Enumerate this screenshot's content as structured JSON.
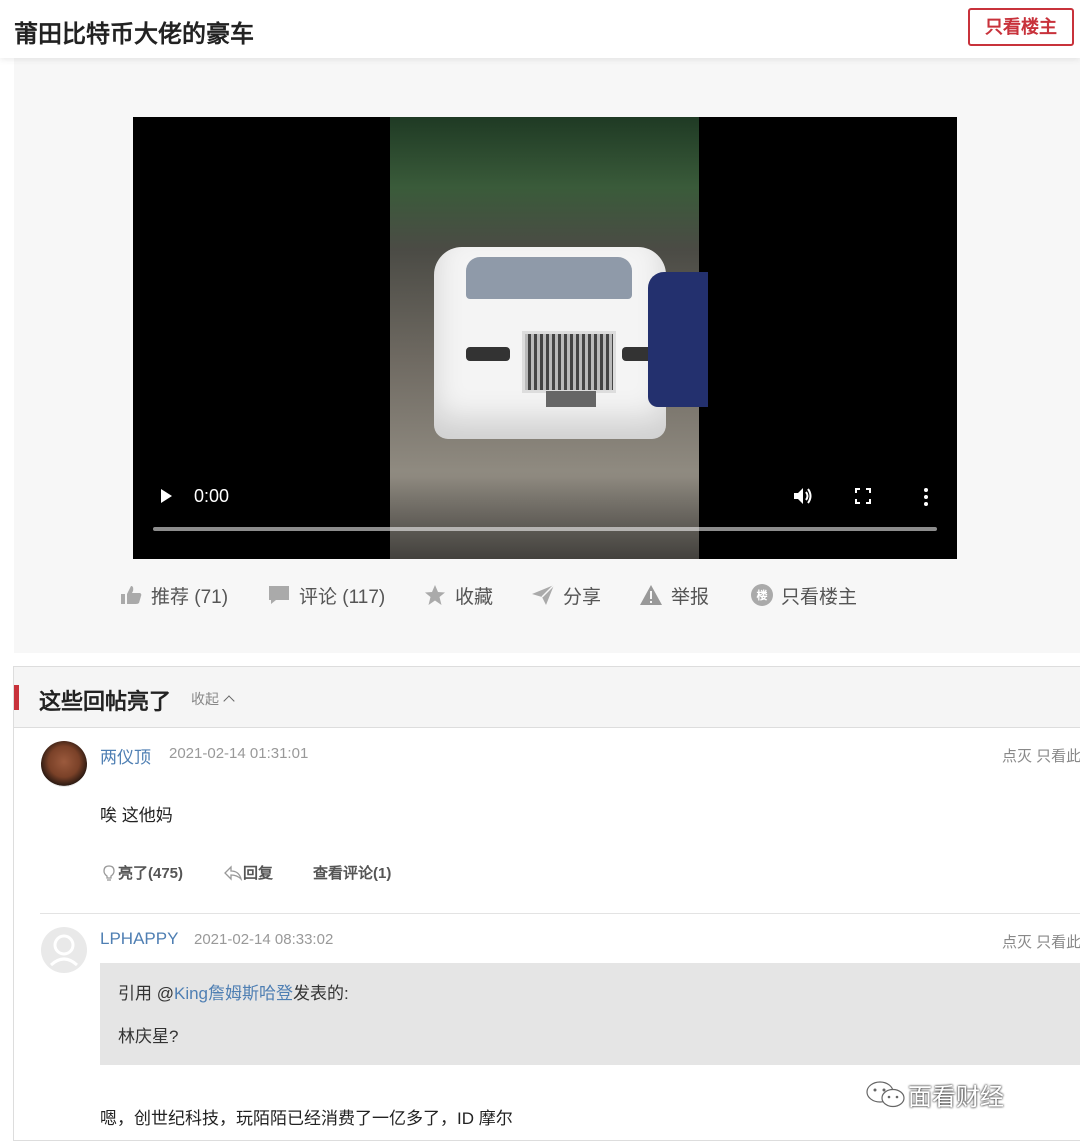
{
  "header": {
    "title": "莆田比特币大佬的豪车",
    "only_op_label": "只看楼主"
  },
  "video": {
    "time": "0:00"
  },
  "post_actions": [
    {
      "label": "推荐 (71)",
      "icon": "thumbs-up-icon"
    },
    {
      "label": "评论 (117)",
      "icon": "comment-icon"
    },
    {
      "label": "收藏",
      "icon": "star-icon"
    },
    {
      "label": "分享",
      "icon": "share-icon"
    },
    {
      "label": "举报",
      "icon": "warning-icon"
    },
    {
      "label": "只看楼主",
      "icon": "floor-icon",
      "icon_char": "楼"
    }
  ],
  "highlights": {
    "title": "这些回帖亮了",
    "collapse_label": "收起",
    "comments": [
      {
        "user": "两仪顶",
        "time": "2021-02-14 01:31:01",
        "right_links": "点灭  只看此",
        "text": "唉 这他妈",
        "actions": {
          "light": "亮了(475)",
          "reply": "回复",
          "view": "查看评论(1)"
        }
      },
      {
        "user": "LPHAPPY",
        "time": "2021-02-14 08:33:02",
        "right_links": "点灭  只看此",
        "quote": {
          "prefix": "引用 @",
          "mention": "King詹姆斯哈登",
          "suffix": "发表的:",
          "text": "林庆星?"
        },
        "text": "嗯，创世纪科技，玩陌陌已经消费了一亿多了，ID 摩尔"
      }
    ]
  },
  "watermark": "面看财经",
  "colors": {
    "accent": "#c8323b",
    "link": "#4f7fb3"
  }
}
